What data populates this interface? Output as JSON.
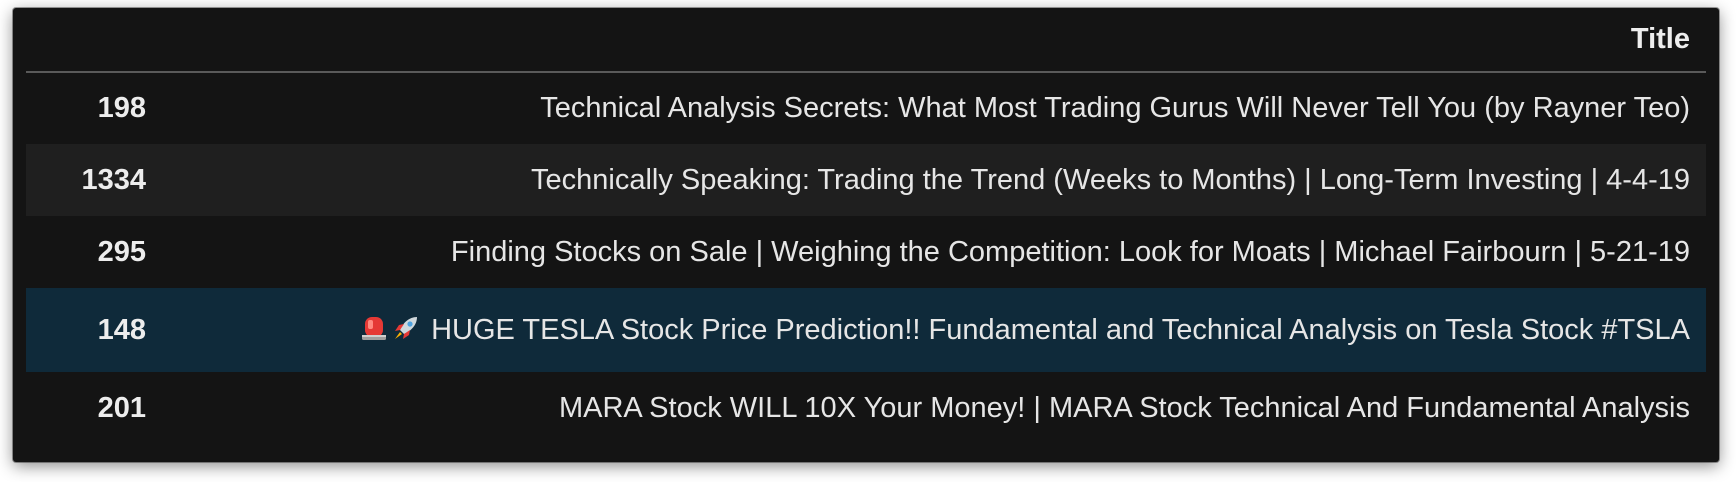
{
  "table": {
    "column_header": "Title",
    "rows": [
      {
        "index": "198",
        "title": "Technical Analysis Secrets: What Most Trading Gurus Will Never Tell You (by Rayner Teo)"
      },
      {
        "index": "1334",
        "title": "Technically Speaking: Trading the Trend (Weeks to Months) | Long-Term Investing | 4-4-19"
      },
      {
        "index": "295",
        "title": "Finding Stocks on Sale | Weighing the Competition: Look for Moats | Michael Fairbourn | 5-21-19"
      },
      {
        "index": "148",
        "title": "HUGE TESLA Stock Price Prediction!! Fundamental and Technical Analysis on Tesla Stock #TSLA",
        "icons": [
          "siren-icon",
          "rocket-icon"
        ]
      },
      {
        "index": "201",
        "title": "MARA Stock WILL 10X Your Money! | MARA Stock Technical And Fundamental Analysis"
      }
    ],
    "highlighted_row": 3
  },
  "colors": {
    "background": "#141414",
    "row_alt": "#1f1f1f",
    "row_highlight": "#0f2a3a",
    "text": "#e6e6e6"
  }
}
